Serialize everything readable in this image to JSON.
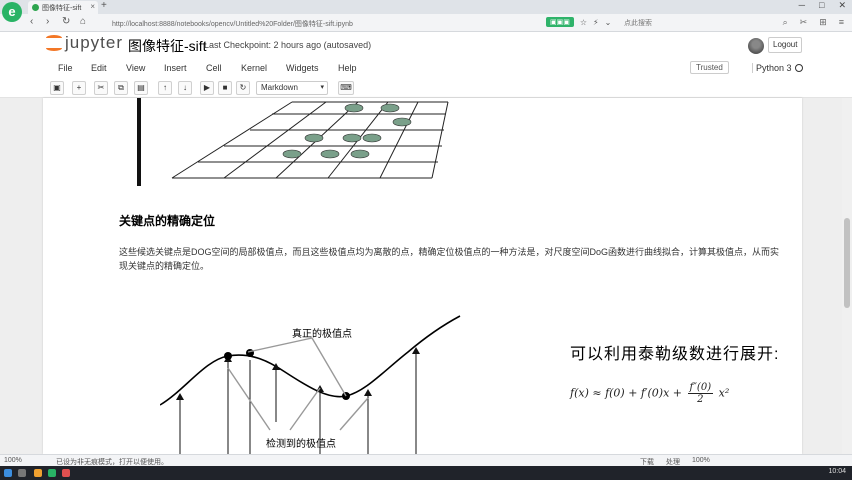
{
  "browser": {
    "logo_letter": "e",
    "tab_title": "图像特征-sift",
    "tab_close": "×",
    "new_tab": "+",
    "url": "http://localhost:8888/notebooks/opencv/Untitled%20Folder/图像特征-sift.ipynb",
    "secure_label": "",
    "search_text": "点此搜索",
    "win_controls": [
      "─",
      "□",
      "✕"
    ],
    "nav": {
      "back": "‹",
      "forward": "›",
      "refresh": "↻",
      "home": "⌂"
    }
  },
  "jupyter": {
    "logo_text": "jupyter",
    "notebook_title": "图像特征-sift",
    "checkpoint": "Last Checkpoint: 2 hours ago (autosaved)",
    "logout": "Logout",
    "menu": [
      "File",
      "Edit",
      "View",
      "Insert",
      "Cell",
      "Kernel",
      "Widgets",
      "Help"
    ],
    "trusted": "Trusted",
    "kernel": "Python 3",
    "toolbar_icons": [
      "save-icon",
      "add-cell-icon",
      "cut-icon",
      "copy-icon",
      "paste-icon",
      "move-up-icon",
      "move-down-icon",
      "run-icon",
      "stop-icon",
      "restart-icon"
    ],
    "cell_type": "Markdown",
    "keyboard_icon": "⌨"
  },
  "content": {
    "heading": "关键点的精确定位",
    "paragraph": "这些候选关键点是DOG空间的局部极值点，而且这些极值点均为离散的点，精确定位极值点的一种方法是，对尺度空间DoG函数进行曲线拟合，计算其极值点，从而实现关键点的精确定位。",
    "figure_label_true": "真正的极值点",
    "figure_label_detected": "检测到的极值点",
    "taylor_title": "可以利用泰勒级数进行展开:",
    "formula": {
      "lhs": "f(x) ≈ f(0) + f′(0)x +",
      "num": "f″(0)",
      "den": "2",
      "tail": "x²"
    }
  },
  "status": {
    "zoom": "100%",
    "message": "已设为非无痕模式，打开以便使用。",
    "right_items": [
      "下载",
      "处理",
      "100%"
    ]
  },
  "taskbar": {
    "clock": "10:04"
  }
}
